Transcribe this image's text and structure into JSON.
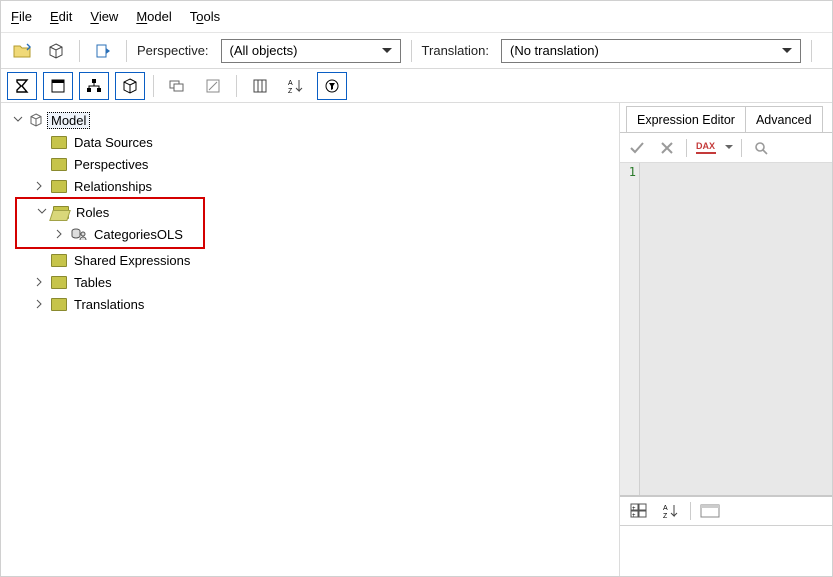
{
  "menu": {
    "file": "File",
    "edit": "Edit",
    "view": "View",
    "model": "Model",
    "tools": "Tools"
  },
  "toolbar1": {
    "perspective_label": "Perspective:",
    "perspective_value": "(All objects)",
    "translation_label": "Translation:",
    "translation_value": "(No translation)"
  },
  "tree": {
    "root": "Model",
    "data_sources": "Data Sources",
    "perspectives": "Perspectives",
    "relationships": "Relationships",
    "roles": "Roles",
    "roles_child": "CategoriesOLS",
    "shared_expr": "Shared Expressions",
    "tables": "Tables",
    "translations": "Translations"
  },
  "right": {
    "tab_editor": "Expression Editor",
    "tab_advanced": "Advanced",
    "dax_label": "DAX",
    "gutter_line": "1"
  }
}
